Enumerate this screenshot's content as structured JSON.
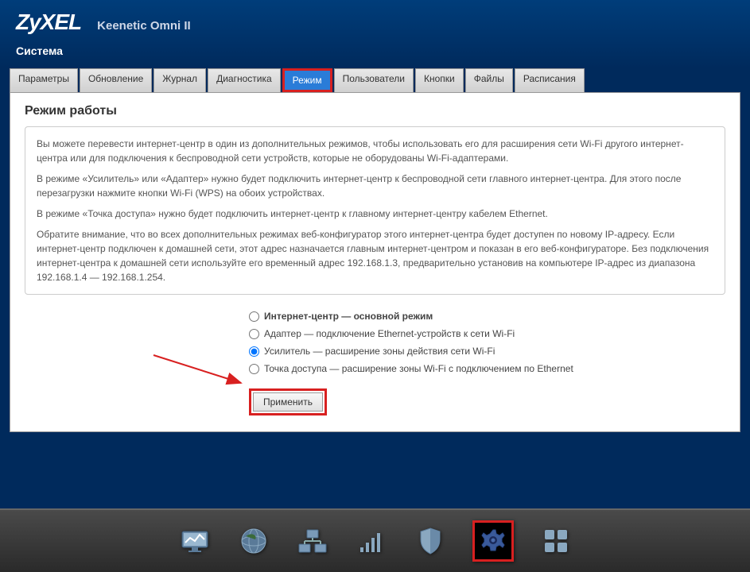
{
  "header": {
    "logo": "ZyXEL",
    "model": "Keenetic Omni II",
    "section": "Система"
  },
  "tabs": [
    {
      "label": "Параметры",
      "active": false
    },
    {
      "label": "Обновление",
      "active": false
    },
    {
      "label": "Журнал",
      "active": false
    },
    {
      "label": "Диагностика",
      "active": false
    },
    {
      "label": "Режим",
      "active": true
    },
    {
      "label": "Пользователи",
      "active": false
    },
    {
      "label": "Кнопки",
      "active": false
    },
    {
      "label": "Файлы",
      "active": false
    },
    {
      "label": "Расписания",
      "active": false
    }
  ],
  "page": {
    "heading": "Режим работы",
    "info": {
      "p1": "Вы можете перевести интернет-центр в один из дополнительных режимов, чтобы использовать его для расширения сети Wi-Fi другого интернет-центра или для подключения к беспроводной сети устройств, которые не оборудованы Wi-Fi-адаптерами.",
      "p2": "В режиме «Усилитель» или «Адаптер» нужно будет подключить интернет-центр к беспроводной сети главного интернет-центра. Для этого после перезагрузки нажмите кнопки Wi-Fi (WPS) на обоих устройствах.",
      "p3": "В режиме «Точка доступа» нужно будет подключить интернет-центр к главному интернет-центру кабелем Ethernet.",
      "p4": "Обратите внимание, что во всех дополнительных режимах веб-конфигуратор этого интернет-центра будет доступен по новому IP-адресу. Если интернет-центр подключен к домашней сети, этот адрес назначается главным интернет-центром и показан в его веб-конфигураторе. Без подключения интернет-центра к домашней сети используйте его временный адрес 192.168.1.3, предварительно установив на компьютере IP-адрес из диапазона 192.168.1.4 — 192.168.1.254."
    },
    "modes": [
      {
        "label": "Интернет-центр — основной режим",
        "selected": false,
        "bold": true
      },
      {
        "label": "Адаптер — подключение Ethernet-устройств к сети Wi-Fi",
        "selected": false,
        "bold": false
      },
      {
        "label": "Усилитель — расширение зоны действия сети Wi-Fi",
        "selected": true,
        "bold": false
      },
      {
        "label": "Точка доступа — расширение зоны Wi-Fi с подключением по Ethernet",
        "selected": false,
        "bold": false
      }
    ],
    "apply_label": "Применить"
  },
  "nav_icons": [
    {
      "name": "monitor-icon",
      "highlighted": false
    },
    {
      "name": "globe-icon",
      "highlighted": false
    },
    {
      "name": "network-icon",
      "highlighted": false
    },
    {
      "name": "wifi-icon",
      "highlighted": false
    },
    {
      "name": "shield-icon",
      "highlighted": false
    },
    {
      "name": "gear-icon",
      "highlighted": true
    },
    {
      "name": "apps-icon",
      "highlighted": false
    }
  ]
}
